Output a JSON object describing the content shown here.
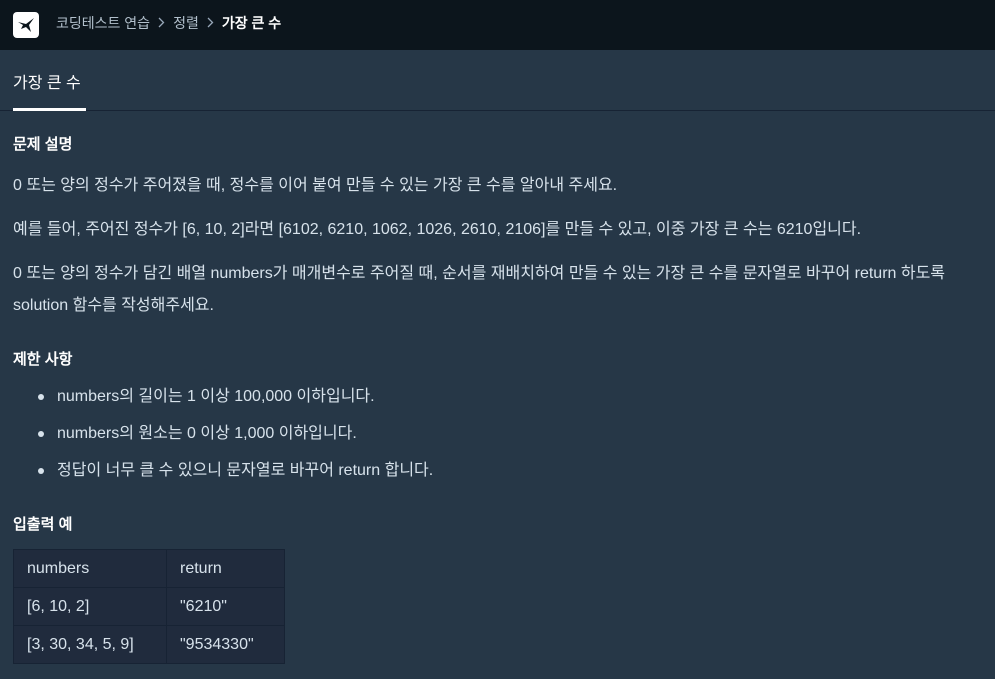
{
  "header": {
    "logo_icon": "programmers-logo-icon",
    "breadcrumb": [
      "코딩테스트 연습",
      "정렬",
      "가장 큰 수"
    ]
  },
  "tab": {
    "title": "가장 큰 수"
  },
  "problem": {
    "desc_title": "문제 설명",
    "paragraphs": [
      "0 또는 양의 정수가 주어졌을 때, 정수를 이어 붙여 만들 수 있는 가장 큰 수를 알아내 주세요.",
      "예를 들어, 주어진 정수가 [6, 10, 2]라면 [6102, 6210, 1062, 1026, 2610, 2106]를 만들 수 있고, 이중 가장 큰 수는 6210입니다.",
      "0 또는 양의 정수가 담긴 배열 numbers가 매개변수로 주어질 때, 순서를 재배치하여 만들 수 있는 가장 큰 수를 문자열로 바꾸어 return 하도록 solution 함수를 작성해주세요."
    ],
    "constraints_title": "제한 사항",
    "constraints": [
      "numbers의 길이는 1 이상 100,000 이하입니다.",
      "numbers의 원소는 0 이상 1,000 이하입니다.",
      "정답이 너무 클 수 있으니 문자열로 바꾸어 return 합니다."
    ],
    "examples_title": "입출력 예",
    "examples_table": {
      "headers": [
        "numbers",
        "return"
      ],
      "rows": [
        [
          "[6, 10, 2]",
          "\"6210\""
        ],
        [
          "[3, 30, 34, 5, 9]",
          "\"9534330\""
        ]
      ]
    }
  },
  "colors": {
    "background": "#263747",
    "topbar": "#0c151c",
    "text": "#d7e2eb",
    "heading": "#ffffff"
  }
}
